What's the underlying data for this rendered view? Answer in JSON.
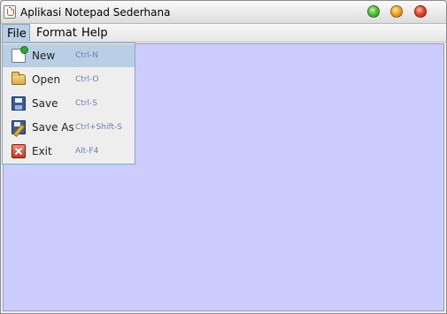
{
  "window": {
    "title": "Aplikasi Notepad Sederhana",
    "icon": "java-cup-icon",
    "controls": [
      "minimize-button-green",
      "maximize-button-orange",
      "close-button-red"
    ]
  },
  "menubar": {
    "items": [
      "File",
      "Format",
      "Help"
    ],
    "active": "File"
  },
  "file_menu": {
    "items": [
      {
        "label": "New",
        "accelerator": "Ctrl-N",
        "icon": "new-document-icon",
        "highlighted": true
      },
      {
        "label": "Open",
        "accelerator": "Ctrl-O",
        "icon": "open-folder-icon"
      },
      {
        "label": "Save",
        "accelerator": "Ctrl-S",
        "icon": "floppy-disk-icon"
      },
      {
        "label": "Save As",
        "accelerator": "Ctrl+Shift-S",
        "icon": "save-as-icon"
      },
      {
        "label": "Exit",
        "accelerator": "Alt-F4",
        "icon": "exit-icon"
      }
    ]
  },
  "editor": {
    "content": "",
    "background": "#ccccff"
  },
  "colors": {
    "menu_highlight": "#b8cfe5",
    "accelerator_text": "#6a7fb0"
  }
}
